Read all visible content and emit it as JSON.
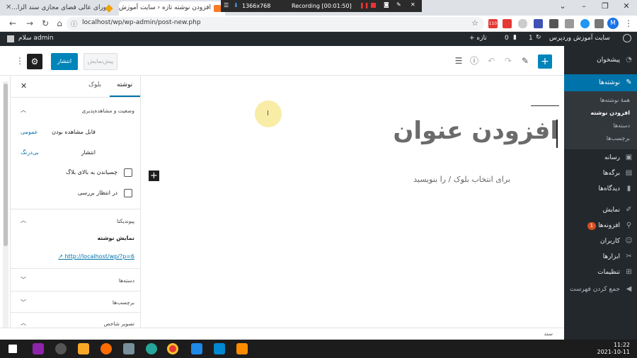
{
  "browser": {
    "tabs": [
      {
        "title": "شورای عالی فضای مجازی سند الزا...",
        "active": false
      },
      {
        "title": "افزودن نوشته تازه ‹ سایت آموزش وردپرس...",
        "active": true
      }
    ],
    "recording": {
      "resolution": "1366x768",
      "status": "Recording [00:01:50]"
    },
    "url": "localhost/wp/wp-admin/post-new.php",
    "profile_initial": "M",
    "ext_badge": "110"
  },
  "adminbar": {
    "site_name": "سایت آموزش وردپرس",
    "updates": "1",
    "comments": "0",
    "new": "+ تازه",
    "greeting": "سلام admin"
  },
  "sidebar": {
    "items": [
      {
        "label": "پیشخوان",
        "icon": "dashboard-icon"
      },
      {
        "label": "نوشته‌ها",
        "icon": "pin-icon"
      },
      {
        "label": "رسانه",
        "icon": "media-icon"
      },
      {
        "label": "برگه‌ها",
        "icon": "pages-icon"
      },
      {
        "label": "دیدگاه‌ها",
        "icon": "comments-icon"
      },
      {
        "label": "نمایش",
        "icon": "brush-icon"
      },
      {
        "label": "افزونه‌ها",
        "icon": "plugin-icon",
        "badge": "1"
      },
      {
        "label": "کاربران",
        "icon": "users-icon"
      },
      {
        "label": "ابزارها",
        "icon": "tools-icon"
      },
      {
        "label": "تنظیمات",
        "icon": "settings-icon"
      },
      {
        "label": "جمع کردن فهرست",
        "icon": "collapse-icon"
      }
    ],
    "submenu": [
      "همهٔ نوشته‌ها",
      "افزودن نوشته",
      "دسته‌ها",
      "برچسب‌ها"
    ]
  },
  "editor": {
    "publish_label": "انتشار",
    "preview_label": "پیش‌نمایش",
    "title": "افزودن عنوان",
    "block_placeholder": "برای انتخاب بلوک / را بنویسید",
    "footer_label": "سند"
  },
  "panel": {
    "tab_post": "نوشته",
    "tab_block": "بلوک",
    "status_title": "وضعیت و مشاهده‌پذیری",
    "visibility_label": "قابل مشاهده بودن",
    "visibility_value": "عمومی",
    "publish_label": "انتشار",
    "publish_value": "بی‌درنگ",
    "stick_label": "چسباندن به بالای بلاگ",
    "pending_label": "در انتظار بررسی",
    "permalink_title": "پیوندیکتا",
    "view_post": "نمایش نوشته",
    "permalink_url": "http://localhost/wp/?p=6",
    "categories_title": "دسته‌ها",
    "tags_title": "برچسب‌ها",
    "featured_title": "تصویر شاخص"
  },
  "taskbar": {
    "time": "11:22",
    "date": "2021-10-11"
  },
  "colors": {
    "wp_blue": "#0073aa",
    "admin_dark": "#23282d",
    "publish_button": "#0085ba"
  }
}
